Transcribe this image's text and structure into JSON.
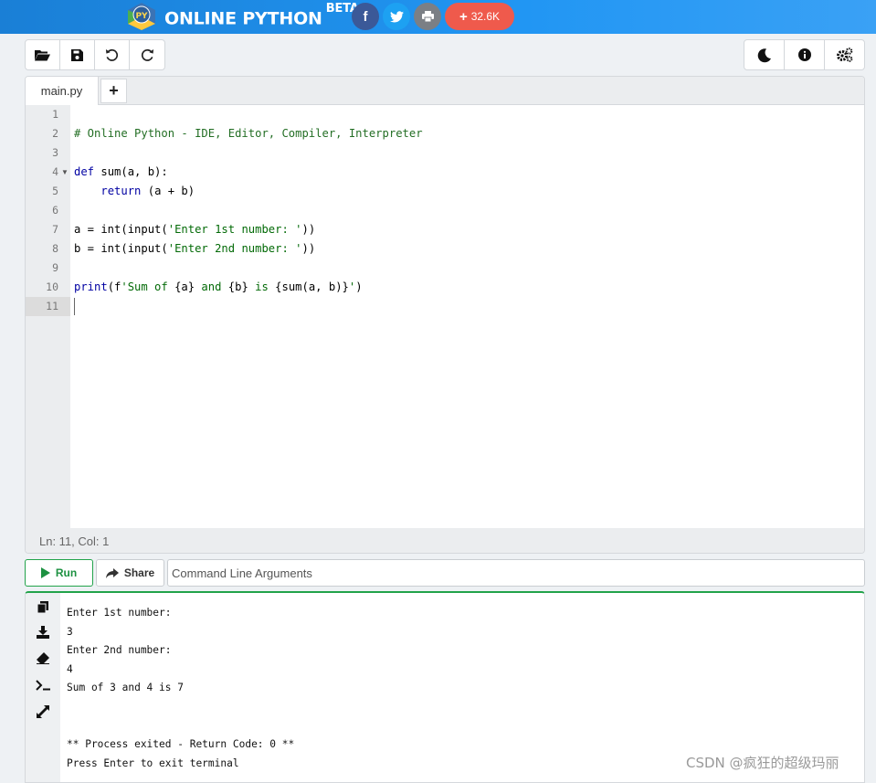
{
  "header": {
    "brand": "ONLINE PYTHON",
    "badge": "BETA",
    "logo_text": "PY",
    "share_count": "32.6K",
    "colors": {
      "bar": "#2196f3",
      "facebook": "#3b5998",
      "twitter": "#1da1f2",
      "print": "#7b7f85",
      "share": "#ef5a4c"
    }
  },
  "toolbar": {
    "left_icons": [
      "folder-open-icon",
      "save-icon",
      "undo-icon",
      "redo-icon"
    ],
    "right_icons": [
      "moon-icon",
      "info-icon",
      "settings-icon"
    ]
  },
  "editor": {
    "tab_name": "main.py",
    "add_tab_label": "+",
    "line_numbers": [
      "1",
      "2",
      "3",
      "4",
      "5",
      "6",
      "7",
      "8",
      "9",
      "10",
      "11"
    ],
    "lines": {
      "l2": "# Online Python - IDE, Editor, Compiler, Interpreter",
      "l4_kw": "def",
      "l4_rest": " sum(a, b):",
      "l5_indent": "    ",
      "l5_kw": "return",
      "l5_rest": " (a + b)",
      "l7_pre": "a = int(input(",
      "l7_str": "'Enter 1st number: '",
      "l7_post": "))",
      "l8_pre": "b = int(input(",
      "l8_str": "'Enter 2nd number: '",
      "l8_post": "))",
      "l10_kw": "print",
      "l10_pre": "(f",
      "l10_str1": "'Sum of ",
      "l10_e1": "{a}",
      "l10_str2": " and ",
      "l10_e2": "{b}",
      "l10_str3": " is ",
      "l10_e3": "{sum(a, b)}",
      "l10_str4": "'",
      "l10_post": ")"
    },
    "status": "Ln: 11,  Col: 1",
    "active_line": 11
  },
  "actions": {
    "run_label": "Run",
    "share_label": "Share",
    "args_placeholder": "Command Line Arguments"
  },
  "terminal": {
    "side_icons": [
      "copy-icon",
      "download-icon",
      "eraser-icon",
      "terminal-icon",
      "expand-icon"
    ],
    "output": [
      "Enter 1st number:",
      "3",
      "Enter 2nd number:",
      "4",
      "Sum of 3 and 4 is 7",
      "",
      "",
      "** Process exited - Return Code: 0 **",
      "Press Enter to exit terminal"
    ]
  },
  "watermark": "CSDN @疯狂的超级玛丽"
}
